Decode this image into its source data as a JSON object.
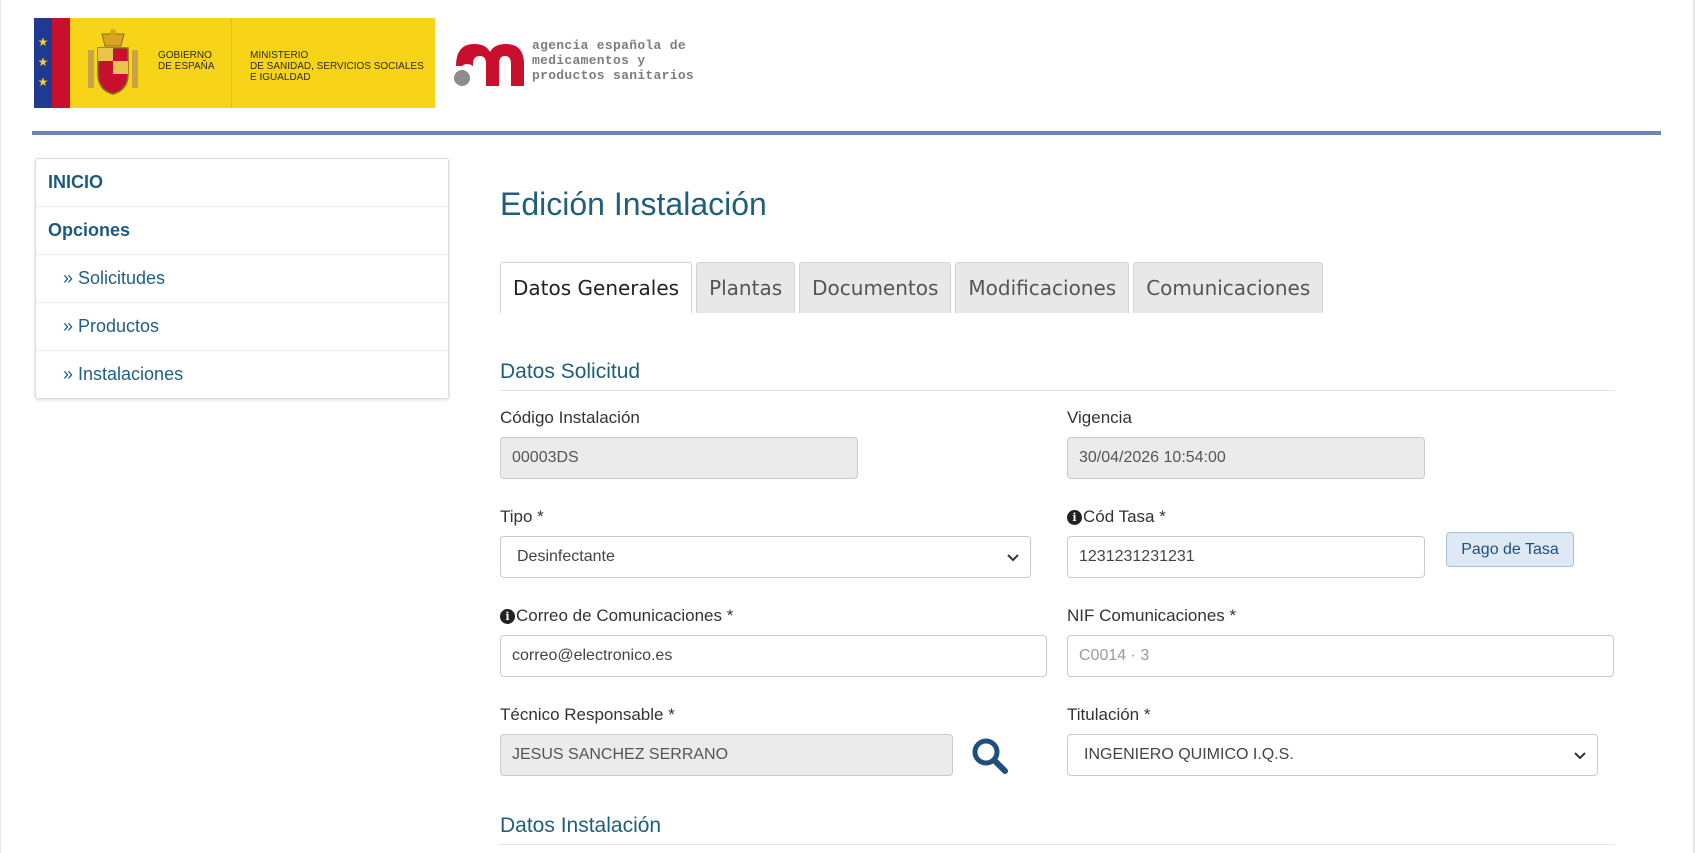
{
  "header": {
    "gov_text": "GOBIERNO\nDE ESPAÑA",
    "ministry_text": "MINISTERIO\nDE SANIDAD, SERVICIOS SOCIALES\nE IGUALDAD",
    "agency_text": "agencia española de\nmedicamentos y\nproductos sanitarios",
    "colors": {
      "banner": "#f7d417",
      "rule": "#6e86b5",
      "agency_red": "#c8102e"
    }
  },
  "sidebar": {
    "items": [
      {
        "label": "INICIO"
      },
      {
        "label": "Opciones"
      },
      {
        "label": "» Solicitudes"
      },
      {
        "label": "» Productos"
      },
      {
        "label": "» Instalaciones"
      }
    ]
  },
  "page": {
    "title": "Edición Instalación"
  },
  "tabs": [
    {
      "label": "Datos Generales",
      "active": true
    },
    {
      "label": "Plantas"
    },
    {
      "label": "Documentos"
    },
    {
      "label": "Modificaciones"
    },
    {
      "label": "Comunicaciones"
    }
  ],
  "sections": {
    "solicitud": "Datos Solicitud",
    "instalacion": "Datos Instalación"
  },
  "form": {
    "codigo_label": "Código Instalación",
    "codigo_value": "00003DS",
    "vigencia_label": "Vigencia",
    "vigencia_value": "30/04/2026 10:54:00",
    "tipo_label": "Tipo *",
    "tipo_value": "Desinfectante",
    "tasa_label": "Cód Tasa *",
    "tasa_value": "1231231231231",
    "pago_button": "Pago de Tasa",
    "correo_label": "Correo de Comunicaciones *",
    "correo_value": "correo@electronico.es",
    "nif_label": "NIF Comunicaciones *",
    "nif_value": "C0014 · 3",
    "tecnico_label": "Técnico Responsable *",
    "tecnico_value": "JESUS SANCHEZ SERRANO",
    "titulacion_label": "Titulación *",
    "titulacion_value": "INGENIERO QUIMICO I.Q.S."
  }
}
